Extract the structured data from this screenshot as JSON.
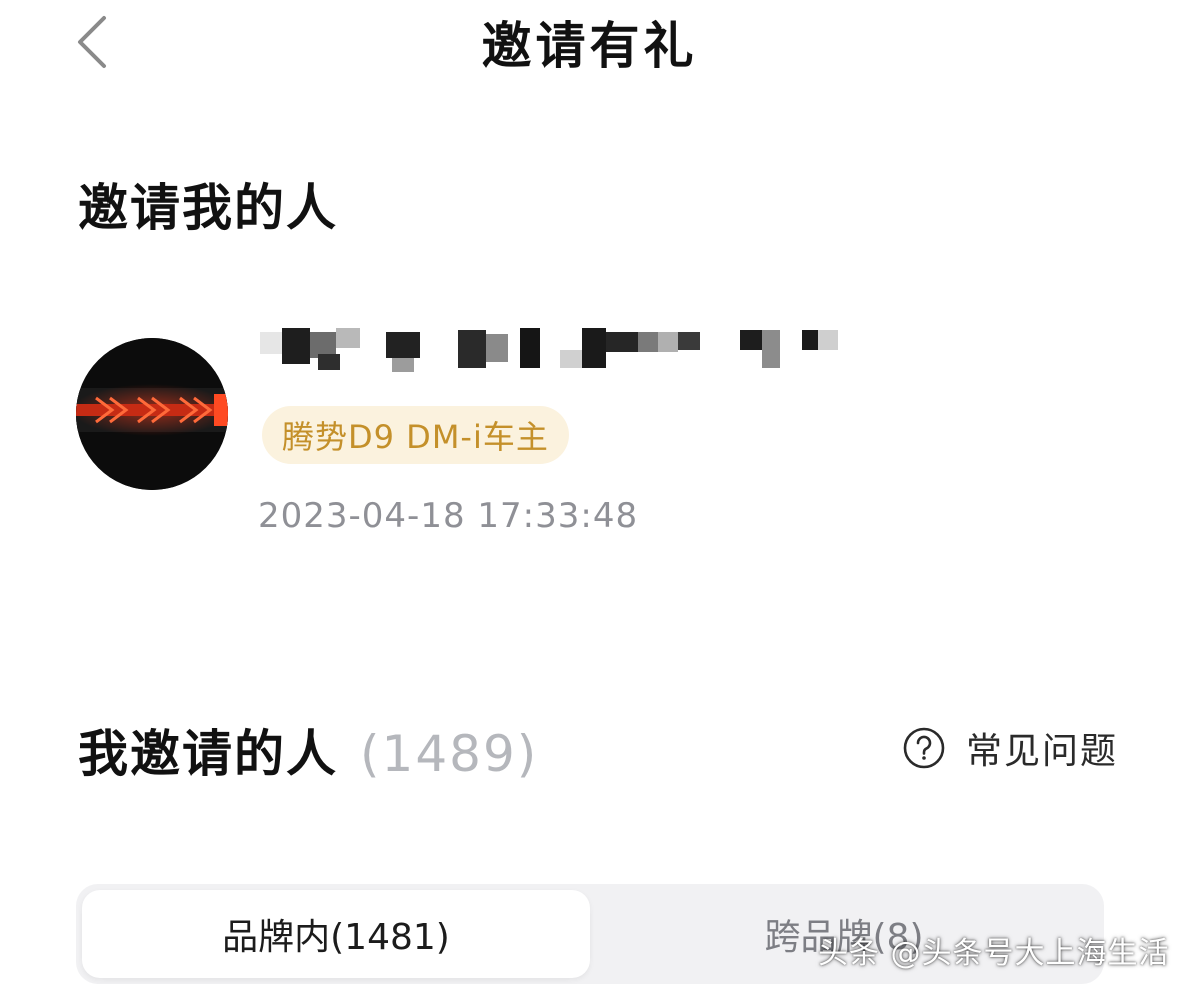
{
  "header": {
    "title": "邀请有礼",
    "back_icon": "chevron-left-icon"
  },
  "inviter_section": {
    "heading": "邀请我的人",
    "badge": "腾势D9 DM-i车主",
    "timestamp": "2023-04-18 17:33:48"
  },
  "invitees_section": {
    "heading": "我邀请的人",
    "count": "(1489)",
    "faq_label": "常见问题",
    "faq_icon": "question-circle-icon"
  },
  "tabs": [
    {
      "label": "品牌内(1481)",
      "active": true
    },
    {
      "label": "跨品牌(8)",
      "active": false
    }
  ],
  "watermark": "头条 @头条号大上海生活",
  "colors": {
    "badge_bg": "#fbf2de",
    "badge_text": "#c4902a",
    "muted": "#8f9096",
    "count": "#b5b7bc",
    "tab_bar": "#f1f1f3"
  }
}
